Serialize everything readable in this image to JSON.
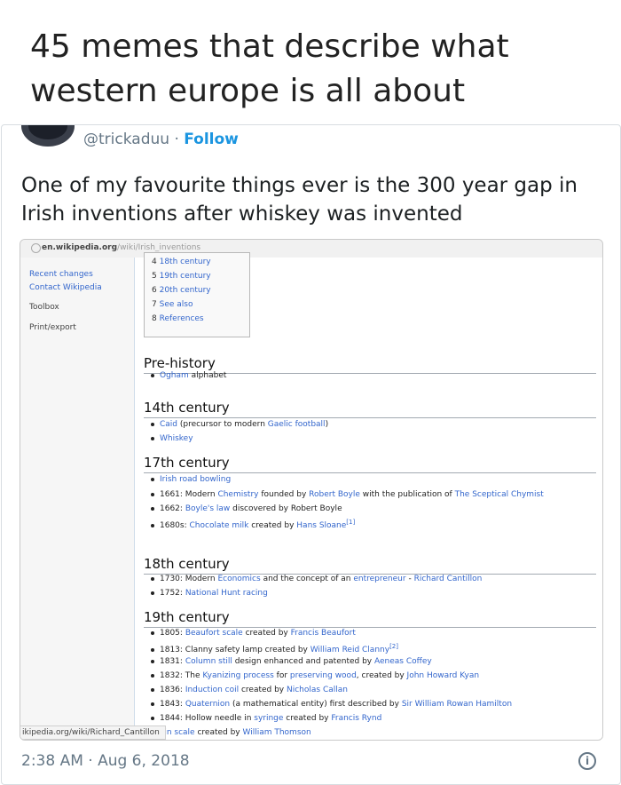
{
  "headline": "45 memes that describe what western europe is all about",
  "tweet": {
    "handle": "@trickaduu",
    "separator": "·",
    "follow_label": "Follow",
    "text": "One of my favourite things ever is the 300 year gap in Irish inventions after whiskey was invented",
    "timestamp": "2:38 AM · Aug 6, 2018",
    "info_icon": "i"
  },
  "screenshot": {
    "url_domain": "en.wikipedia.org",
    "url_path": "/wiki/Irish_inventions",
    "sidebar": [
      "Recent changes",
      "Contact Wikipedia",
      "Toolbox",
      "Print/export"
    ],
    "toc": [
      {
        "num": "4",
        "label": "18th century"
      },
      {
        "num": "5",
        "label": "19th century"
      },
      {
        "num": "6",
        "label": "20th century"
      },
      {
        "num": "7",
        "label": "See also"
      },
      {
        "num": "8",
        "label": "References"
      }
    ],
    "sections": [
      {
        "title": "Pre-history",
        "items": [
          [
            "Ogham",
            " alphabet"
          ]
        ]
      },
      {
        "title": "14th century",
        "items": [
          [
            "Caid",
            " (precursor to modern ",
            "Gaelic football",
            ")"
          ],
          [
            "Whiskey"
          ]
        ]
      },
      {
        "title": "17th century",
        "items": [
          [
            "Irish road bowling"
          ],
          [
            "1661: Modern ",
            "Chemistry",
            " founded by ",
            "Robert Boyle",
            " with the publication of ",
            "The Sceptical Chymist"
          ],
          [
            "1662: ",
            "Boyle's law",
            " discovered by Robert Boyle"
          ],
          [
            "1680s: ",
            "Chocolate milk",
            " created by ",
            "Hans Sloane",
            "[1]"
          ]
        ]
      },
      {
        "title": "18th century",
        "items": [
          [
            "1730: Modern ",
            "Economics",
            " and the concept of an ",
            "entrepreneur",
            " - ",
            "Richard Cantillon"
          ],
          [
            "1752: ",
            "National Hunt racing"
          ]
        ]
      },
      {
        "title": "19th century",
        "items": [
          [
            "1805: ",
            "Beaufort scale",
            " created by ",
            "Francis Beaufort"
          ],
          [
            "1813: Clanny safety lamp created by ",
            "William Reid Clanny",
            "[2]"
          ],
          [
            "1831: ",
            "Column still",
            " design enhanced and patented by ",
            "Aeneas Coffey"
          ],
          [
            "1832: The ",
            "Kyanizing process",
            " for ",
            "preserving wood",
            ", created by ",
            "John Howard Kyan"
          ],
          [
            "1836: ",
            "Induction coil",
            " created by ",
            "Nicholas Callan"
          ],
          [
            "1843: ",
            "Quaternion",
            " (a mathematical entity) first described by ",
            "Sir William Rowan Hamilton"
          ],
          [
            "1844: Hollow needle in ",
            "syringe",
            " created by ",
            "Francis Rynd"
          ],
          [
            "",
            "vin scale",
            " created by ",
            "William Thomson"
          ]
        ]
      }
    ],
    "status_url": "ikipedia.org/wiki/Richard_Cantillon"
  },
  "colors": {
    "link": "#3366cc",
    "follow": "#1b95e0",
    "meta": "#657786"
  }
}
